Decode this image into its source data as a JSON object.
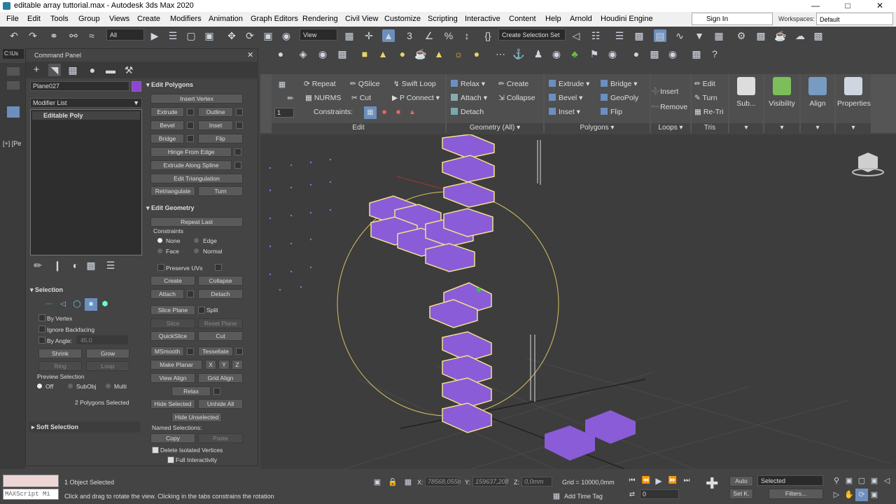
{
  "titlebar": {
    "title": "editable array tuttorial.max - Autodesk 3ds Max 2020"
  },
  "menubar": {
    "items": [
      "File",
      "Edit",
      "Tools",
      "Group",
      "Views",
      "Create",
      "Modifiers",
      "Animation",
      "Graph Editors",
      "Rendering",
      "Civil View",
      "Customize",
      "Scripting",
      "Interactive",
      "Content",
      "Help",
      "Arnold",
      "Houdini Engine"
    ],
    "signin": "Sign In",
    "workspaces_label": "Workspaces:",
    "workspace": "Default"
  },
  "toolbar": {
    "filter": "All",
    "view": "View",
    "selection_set": "Create Selection Set"
  },
  "leftstrip": {
    "path": "C:\\Us"
  },
  "command_panel": {
    "title": "Command Panel",
    "object_name": "Plane027",
    "object_color": "#8e44d8",
    "modifier_list": "Modifier List",
    "stack_item": "Editable Poly"
  },
  "edit_polygons": {
    "header": "Edit Polygons",
    "insert_vertex": "Insert Vertex",
    "extrude": "Extrude",
    "outline": "Outline",
    "bevel": "Bevel",
    "inset": "Inset",
    "bridge": "Bridge",
    "flip": "Flip",
    "hinge": "Hinge From Edge",
    "extrude_spline": "Extrude Along Spline",
    "edit_tri": "Edit Triangulation",
    "retri": "Retriangulate",
    "turn": "Turn"
  },
  "edit_geometry": {
    "header": "Edit Geometry",
    "repeat_last": "Repeat Last",
    "constraints": "Constraints",
    "none": "None",
    "edge": "Edge",
    "face": "Face",
    "normal": "Normal",
    "preserve_uvs": "Preserve UVs",
    "create": "Create",
    "collapse": "Collapse",
    "attach": "Attach",
    "detach": "Detach",
    "slice_plane": "Slice Plane",
    "split": "Split",
    "slice": "Slice",
    "reset_plane": "Reset Plane",
    "quickslice": "QuickSlice",
    "cut": "Cut",
    "msmooth": "MSmooth",
    "tessellate": "Tessellate",
    "make_planar": "Make Planar",
    "x": "X",
    "y": "Y",
    "z": "Z",
    "view_align": "View Align",
    "grid_align": "Grid Align",
    "relax": "Relax",
    "hide_selected": "Hide Selected",
    "unhide_all": "Unhide All",
    "hide_unselected": "Hide Unselected",
    "named_sel": "Named Selections:",
    "copy": "Copy",
    "paste": "Paste",
    "delete_iso": "Delete Isolated Vertices",
    "full_inter": "Full Interactivity"
  },
  "selection": {
    "header": "Selection",
    "by_vertex": "By Vertex",
    "ignore_backfacing": "Ignore Backfacing",
    "by_angle": "By Angle:",
    "angle_value": "45,0",
    "shrink": "Shrink",
    "grow": "Grow",
    "ring": "Ring",
    "loop": "Loop",
    "preview": "Preview Selection",
    "off": "Off",
    "subobj": "SubObj",
    "multi": "Multi",
    "selected_count": "2 Polygons Selected",
    "soft": "Soft Selection"
  },
  "ribbon": {
    "repeat": "Repeat",
    "qslice": "QSlice",
    "swift_loop": "Swift Loop",
    "nurms": "NURMS",
    "cut": "Cut",
    "p_connect": "P Connect",
    "constraints": "Constraints:",
    "edit": "Edit",
    "relax": "Relax",
    "create": "Create",
    "attach": "Attach",
    "collapse": "Collapse",
    "detach": "Detach",
    "geometry_all": "Geometry (All)",
    "extrude": "Extrude",
    "bridge": "Bridge",
    "bevel": "Bevel",
    "geopoly": "GeoPoly",
    "inset": "Inset",
    "flip": "Flip",
    "polygons": "Polygons",
    "insert": "Insert",
    "remove": "Remove",
    "loops": "Loops",
    "tri_edit": "Edit",
    "tri_turn": "Turn",
    "retri": "Re-Tri",
    "tris": "Tris",
    "sub": "Sub...",
    "visibility": "Visibility",
    "align": "Align",
    "properties": "Properties",
    "spinner_value": "1"
  },
  "viewport": {
    "label": "[+] [Pe"
  },
  "status": {
    "maxscript": "MAXScript Mi",
    "objects": "1 Object Selected",
    "hint": "Click and drag to rotate the view.  Clicking in the tabs constrains the rotation",
    "x_label": "X:",
    "x_value": "78568,055n",
    "y_label": "Y:",
    "y_value": "159637,208",
    "z_label": "Z:",
    "z_value": "0,0mm",
    "grid": "Grid = 10000,0mm",
    "add_time_tag": "Add Time Tag",
    "frame": "0",
    "auto": "Auto",
    "set_key": "Set K.",
    "selected": "Selected",
    "filters": "Filters..."
  }
}
